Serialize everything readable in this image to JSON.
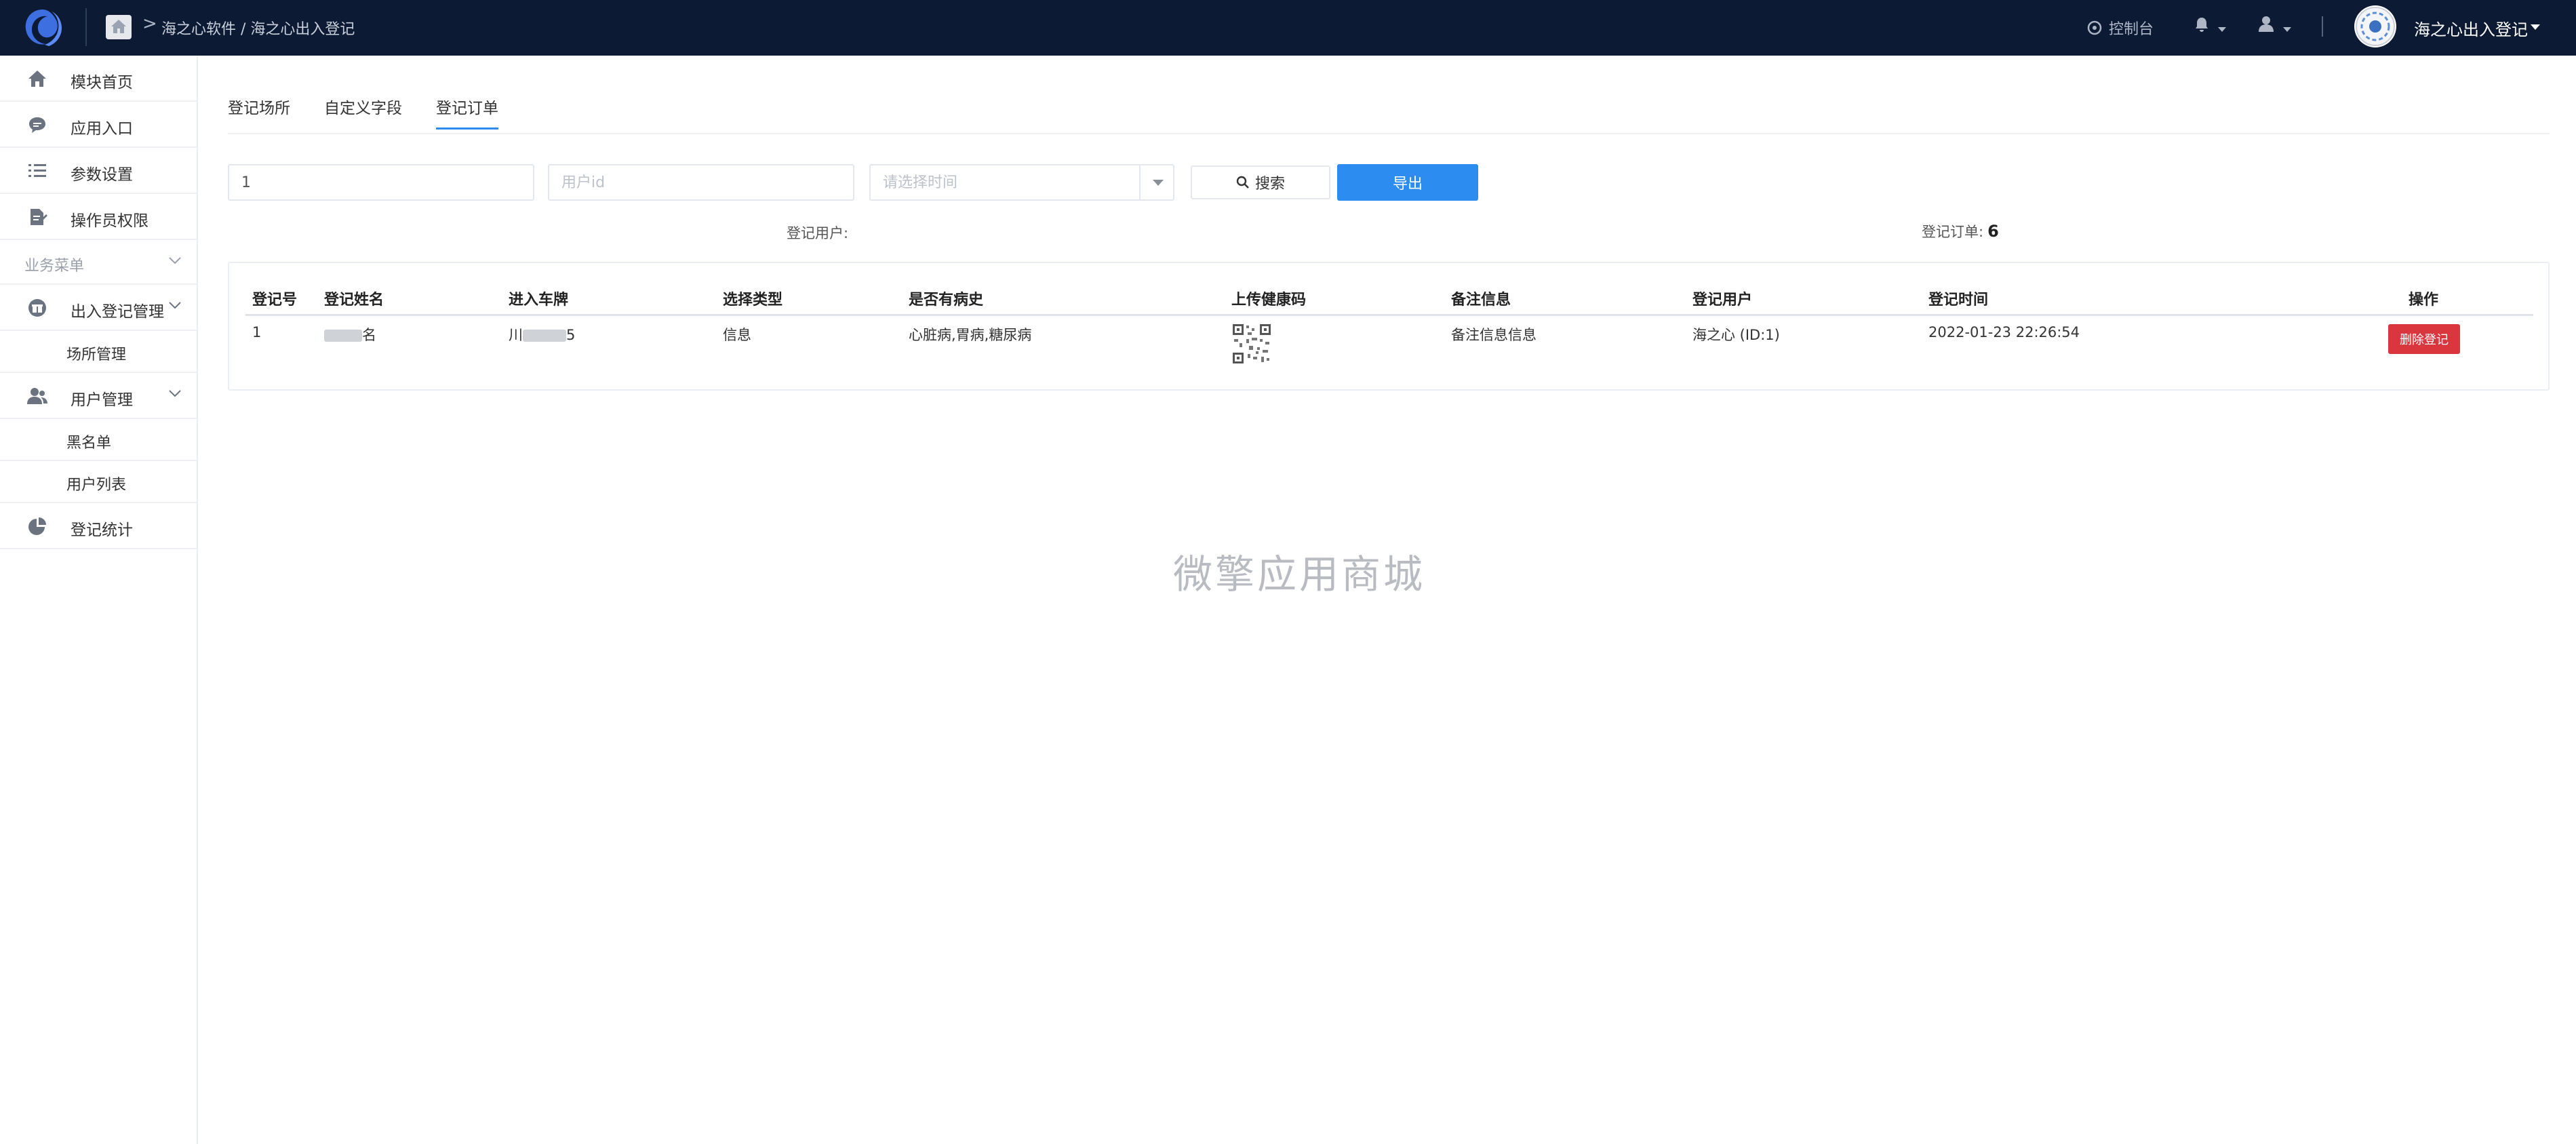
{
  "header": {
    "breadcrumb_sep": ">",
    "breadcrumb": "海之心软件 / 海之心出入登记",
    "console_label": "控制台",
    "account_name": "海之心出入登记"
  },
  "sidebar": {
    "items": [
      {
        "label": "模块首页",
        "icon": "home-icon"
      },
      {
        "label": "应用入口",
        "icon": "chat-icon"
      },
      {
        "label": "参数设置",
        "icon": "list-icon"
      },
      {
        "label": "操作员权限",
        "icon": "document-edit-icon"
      }
    ],
    "group_label": "业务菜单",
    "menus": [
      {
        "label": "出入登记管理",
        "icon": "gift-icon",
        "children": [
          "场所管理"
        ]
      },
      {
        "label": "用户管理",
        "icon": "users-icon",
        "children": [
          "黑名单",
          "用户列表"
        ]
      },
      {
        "label": "登记统计",
        "icon": "pie-icon"
      }
    ]
  },
  "tabs": [
    {
      "label": "登记场所",
      "active": false
    },
    {
      "label": "自定义字段",
      "active": false
    },
    {
      "label": "登记订单",
      "active": true
    }
  ],
  "filters": {
    "keyword_value": "1",
    "userid_placeholder": "用户id",
    "date_placeholder": "请选择时间",
    "search_label": "搜索",
    "export_label": "导出"
  },
  "stats": {
    "user_label": "登记用户:",
    "order_label": "登记订单:",
    "order_count": "6"
  },
  "table": {
    "columns": [
      "登记号",
      "登记姓名",
      "进入车牌",
      "选择类型",
      "是否有病史",
      "上传健康码",
      "备注信息",
      "登记用户",
      "登记时间",
      "操作"
    ],
    "rows": [
      {
        "id": "1",
        "name_suffix": "名",
        "plate_prefix": "川",
        "plate_suffix": "5",
        "type": "信息",
        "history": "心脏病,胃病,糖尿病",
        "remark": "备注信息信息",
        "user": "海之心 (ID:1)",
        "time": "2022-01-23 22:26:54",
        "action_label": "删除登记"
      }
    ]
  },
  "watermark": "微擎应用商城",
  "colors": {
    "topbar_bg": "#0c1a33",
    "primary": "#2d8cf0",
    "danger": "#d9363e"
  }
}
